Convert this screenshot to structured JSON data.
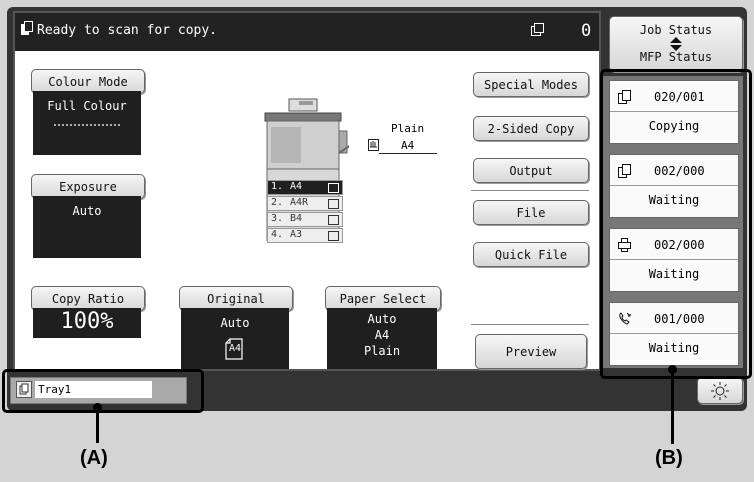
{
  "status": {
    "message": "Ready to scan for copy.",
    "count": "0"
  },
  "left": {
    "colour_mode": {
      "label": "Colour Mode",
      "value": "Full Colour"
    },
    "exposure": {
      "label": "Exposure",
      "value": "Auto"
    },
    "copy_ratio": {
      "label": "Copy Ratio",
      "value": "100%"
    }
  },
  "original": {
    "label": "Original",
    "value": "Auto",
    "doc_size": "A4"
  },
  "paper_select": {
    "label": "Paper Select",
    "lines": [
      "Auto",
      "A4",
      "Plain"
    ]
  },
  "machine": {
    "output_type": "Plain",
    "output_size": "A4",
    "trays": [
      {
        "num": "1.",
        "size": "A4",
        "selected": true
      },
      {
        "num": "2.",
        "size": "A4R",
        "selected": false
      },
      {
        "num": "3.",
        "size": "B4",
        "selected": false
      },
      {
        "num": "4.",
        "size": "A3",
        "selected": false
      }
    ]
  },
  "buttons": {
    "special_modes": "Special Modes",
    "two_sided": "2-Sided Copy",
    "output": "Output",
    "file": "File",
    "quick_file": "Quick File",
    "preview": "Preview"
  },
  "bottom": {
    "tray": "Tray1"
  },
  "job_status": {
    "label_top": "Job Status",
    "label_bottom": "MFP Status",
    "jobs": [
      {
        "icon": "copy-icon",
        "count": "020/001",
        "state": "Copying"
      },
      {
        "icon": "copy-icon",
        "count": "002/000",
        "state": "Waiting"
      },
      {
        "icon": "print-icon",
        "count": "002/000",
        "state": "Waiting"
      },
      {
        "icon": "fax-icon",
        "count": "001/000",
        "state": "Waiting"
      }
    ]
  },
  "callouts": {
    "a": "(A)",
    "b": "(B)"
  }
}
